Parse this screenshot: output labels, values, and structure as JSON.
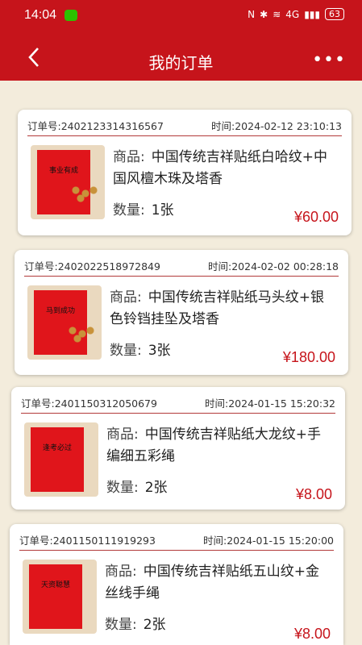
{
  "status_bar": {
    "time": "14:04",
    "battery": "63",
    "network": "4G"
  },
  "header": {
    "title": "我的订单"
  },
  "orders": [
    {
      "order_label": "订单号:",
      "order_no": "2402123314316567",
      "time_label": "时间:",
      "time": "2024-02-12 23:10:13",
      "goods_label": "商品:",
      "goods": "中国传统吉祥贴纸白哈纹+中国风檀木珠及塔香",
      "qty_label": "数量:",
      "qty": "1张",
      "price": "¥60.00",
      "thumb_text": "事业有成"
    },
    {
      "order_label": "订单号:",
      "order_no": "2402022518972849",
      "time_label": "时间:",
      "time": "2024-02-02 00:28:18",
      "goods_label": "商品:",
      "goods": "中国传统吉祥贴纸马头纹+银色铃铛挂坠及塔香",
      "qty_label": "数量:",
      "qty": "3张",
      "price": "¥180.00",
      "thumb_text": "马到成功"
    },
    {
      "order_label": "订单号:",
      "order_no": "2401150312050679",
      "time_label": "时间:",
      "time": "2024-01-15 15:20:32",
      "goods_label": "商品:",
      "goods": "中国传统吉祥贴纸大龙纹+手编细五彩绳",
      "qty_label": "数量:",
      "qty": "2张",
      "price": "¥8.00",
      "thumb_text": "逢考必过"
    },
    {
      "order_label": "订单号:",
      "order_no": "2401150111919293",
      "time_label": "时间:",
      "time": "2024-01-15 15:20:00",
      "goods_label": "商品:",
      "goods": "中国传统吉祥贴纸五山纹+金丝线手绳",
      "qty_label": "数量:",
      "qty": "2张",
      "price": "¥8.00",
      "thumb_text": "天资聪慧"
    }
  ],
  "colors": {
    "accent": "#c6141b",
    "background": "#f3ecdc"
  }
}
